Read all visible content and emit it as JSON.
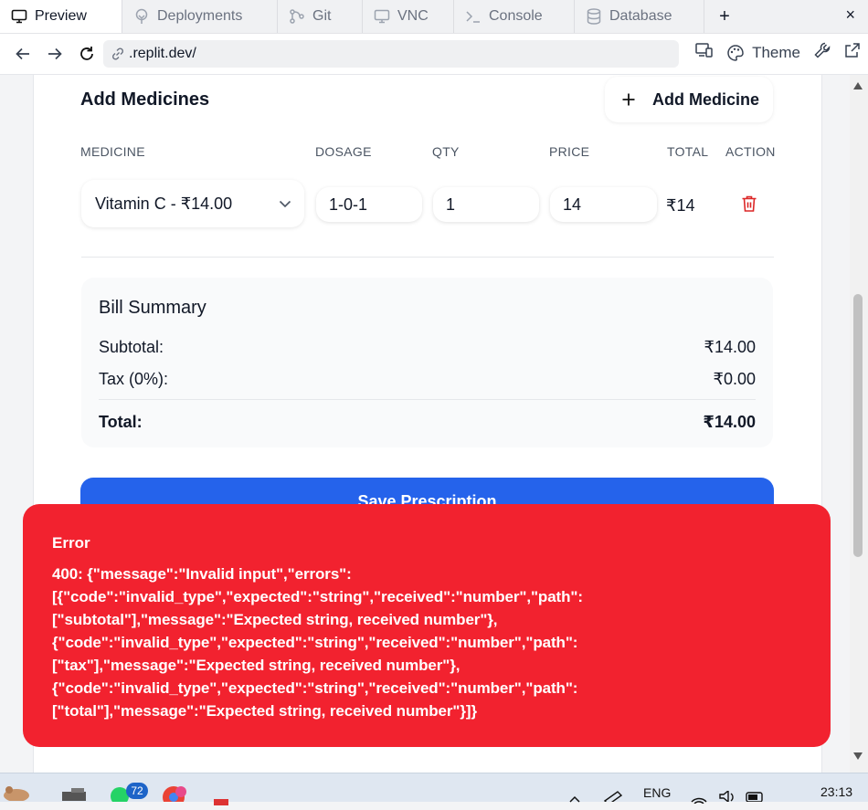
{
  "browser": {
    "tabs": [
      {
        "label": "Preview",
        "icon": "monitor-icon",
        "active": true
      },
      {
        "label": "Deployments",
        "icon": "deploy-icon",
        "active": false
      },
      {
        "label": "Git",
        "icon": "git-icon",
        "active": false
      },
      {
        "label": "VNC",
        "icon": "monitor-icon",
        "active": false
      },
      {
        "label": "Console",
        "icon": "terminal-icon",
        "active": false
      },
      {
        "label": "Database",
        "icon": "database-icon",
        "active": false
      }
    ],
    "new_tab": "+",
    "close": "×",
    "url": ".replit.dev/",
    "theme_label": "Theme"
  },
  "medicines": {
    "title": "Add Medicines",
    "add_button": "Add Medicine",
    "columns": [
      "MEDICINE",
      "DOSAGE",
      "QTY",
      "PRICE",
      "TOTAL",
      "ACTION"
    ],
    "row": {
      "medicine": "Vitamin C - ₹14.00",
      "dosage": "1-0-1",
      "qty": "1",
      "price": "14",
      "total": "₹14"
    }
  },
  "bill": {
    "title": "Bill Summary",
    "subtotal_label": "Subtotal:",
    "subtotal_value": "₹14.00",
    "tax_label": "Tax (0%):",
    "tax_value": "₹0.00",
    "total_label": "Total:",
    "total_value": "₹14.00"
  },
  "save_button": "Save Prescription",
  "error": {
    "title": "Error",
    "message": "400: {\"message\":\"Invalid input\",\"errors\":\n[{\"code\":\"invalid_type\",\"expected\":\"string\",\"received\":\"number\",\"path\":\n[\"subtotal\"],\"message\":\"Expected string, received number\"},\n{\"code\":\"invalid_type\",\"expected\":\"string\",\"received\":\"number\",\"path\":\n[\"tax\"],\"message\":\"Expected string, received number\"},\n{\"code\":\"invalid_type\",\"expected\":\"string\",\"received\":\"number\",\"path\":\n[\"total\"],\"message\":\"Expected string, received number\"}]}"
  },
  "taskbar": {
    "badge": "72",
    "lang": "ENG",
    "time": "23:13"
  },
  "colors": {
    "primary": "#2563eb",
    "error": "#f2222f",
    "delete": "#dc2626"
  }
}
